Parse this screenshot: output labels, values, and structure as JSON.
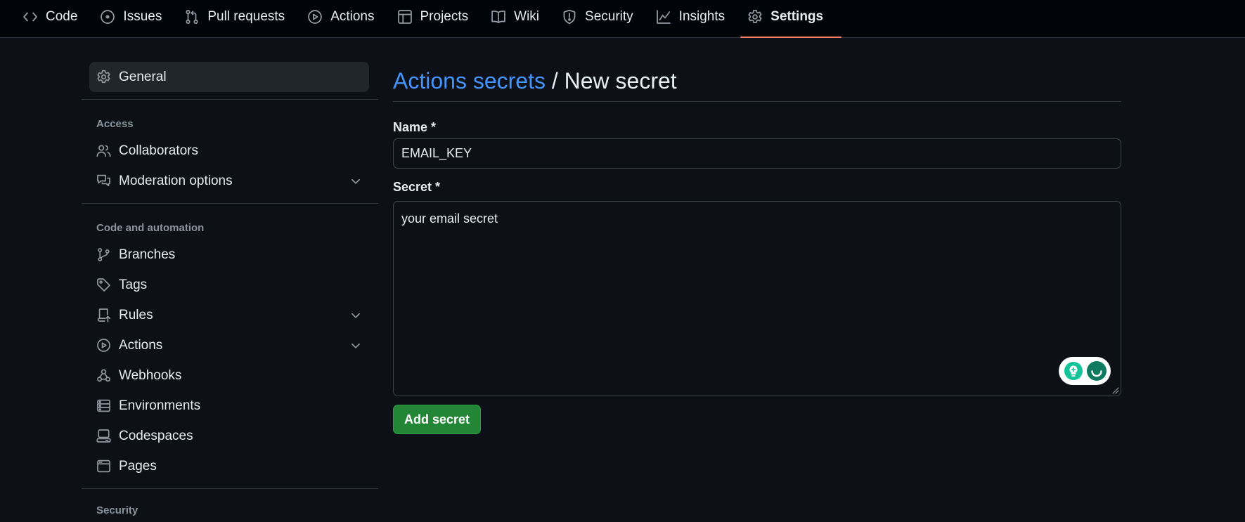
{
  "nav": {
    "tabs": [
      {
        "label": "Code",
        "icon": "code-icon"
      },
      {
        "label": "Issues",
        "icon": "issue-icon"
      },
      {
        "label": "Pull requests",
        "icon": "pull-request-icon"
      },
      {
        "label": "Actions",
        "icon": "play-icon"
      },
      {
        "label": "Projects",
        "icon": "table-icon"
      },
      {
        "label": "Wiki",
        "icon": "book-icon"
      },
      {
        "label": "Security",
        "icon": "shield-icon"
      },
      {
        "label": "Insights",
        "icon": "graph-icon"
      },
      {
        "label": "Settings",
        "icon": "gear-icon",
        "active": true
      }
    ],
    "active_underline_color": "#f78166"
  },
  "sidebar": {
    "general": {
      "label": "General",
      "icon": "gear-icon"
    },
    "access": {
      "heading": "Access",
      "items": [
        {
          "label": "Collaborators",
          "icon": "people-icon"
        },
        {
          "label": "Moderation options",
          "icon": "comment-discussion-icon",
          "expandable": true
        }
      ]
    },
    "code_automation": {
      "heading": "Code and automation",
      "items": [
        {
          "label": "Branches",
          "icon": "git-branch-icon"
        },
        {
          "label": "Tags",
          "icon": "tag-icon"
        },
        {
          "label": "Rules",
          "icon": "repo-push-icon",
          "expandable": true
        },
        {
          "label": "Actions",
          "icon": "play-icon",
          "expandable": true
        },
        {
          "label": "Webhooks",
          "icon": "webhook-icon"
        },
        {
          "label": "Environments",
          "icon": "server-icon"
        },
        {
          "label": "Codespaces",
          "icon": "codespaces-icon"
        },
        {
          "label": "Pages",
          "icon": "browser-icon"
        }
      ]
    },
    "security": {
      "heading": "Security"
    }
  },
  "main": {
    "breadcrumb_link": "Actions secrets",
    "separator": " / ",
    "title": "New secret",
    "name_label": "Name *",
    "name_value": "EMAIL_KEY",
    "secret_label": "Secret *",
    "secret_value": "your email secret",
    "submit_label": "Add secret"
  },
  "colors": {
    "background": "#0d1117",
    "link": "#4493f8",
    "primary_button": "#238636"
  }
}
